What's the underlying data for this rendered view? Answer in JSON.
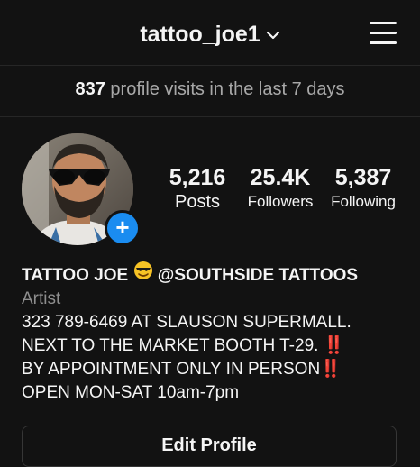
{
  "header": {
    "username": "tattoo_joe1",
    "chevron_icon": "chevron-down-icon",
    "menu_icon": "hamburger-menu-icon"
  },
  "insights": {
    "count": "837",
    "text": "profile visits in the last 7 days"
  },
  "profile": {
    "add_icon": "plus-icon",
    "stats": {
      "posts_value": "5,216",
      "posts_label": "Posts",
      "followers_value": "25.4K",
      "followers_label": "Followers",
      "following_value": "5,387",
      "following_label": "Following"
    }
  },
  "bio": {
    "name_part1": "TATTOO JOE",
    "name_emoji": "smiling-face-with-sunglasses-emoji",
    "name_part2": "@SOUTHSIDE TATTOOS",
    "category": "Artist",
    "line1": "323 789-6469 AT SLAUSON SUPERMALL.",
    "line2": "NEXT TO THE MARKET BOOTH T-29.",
    "line2_mark": "‼️",
    "line3": "BY APPOINTMENT ONLY IN PERSON",
    "line3_mark": "‼️",
    "line4": "OPEN MON-SAT 10am-7pm"
  },
  "actions": {
    "edit_profile": "Edit Profile"
  },
  "colors": {
    "background": "#121212",
    "accent_blue": "#1a8cf0",
    "muted_text": "#a8a8a8",
    "alert_red": "#e0242c"
  }
}
